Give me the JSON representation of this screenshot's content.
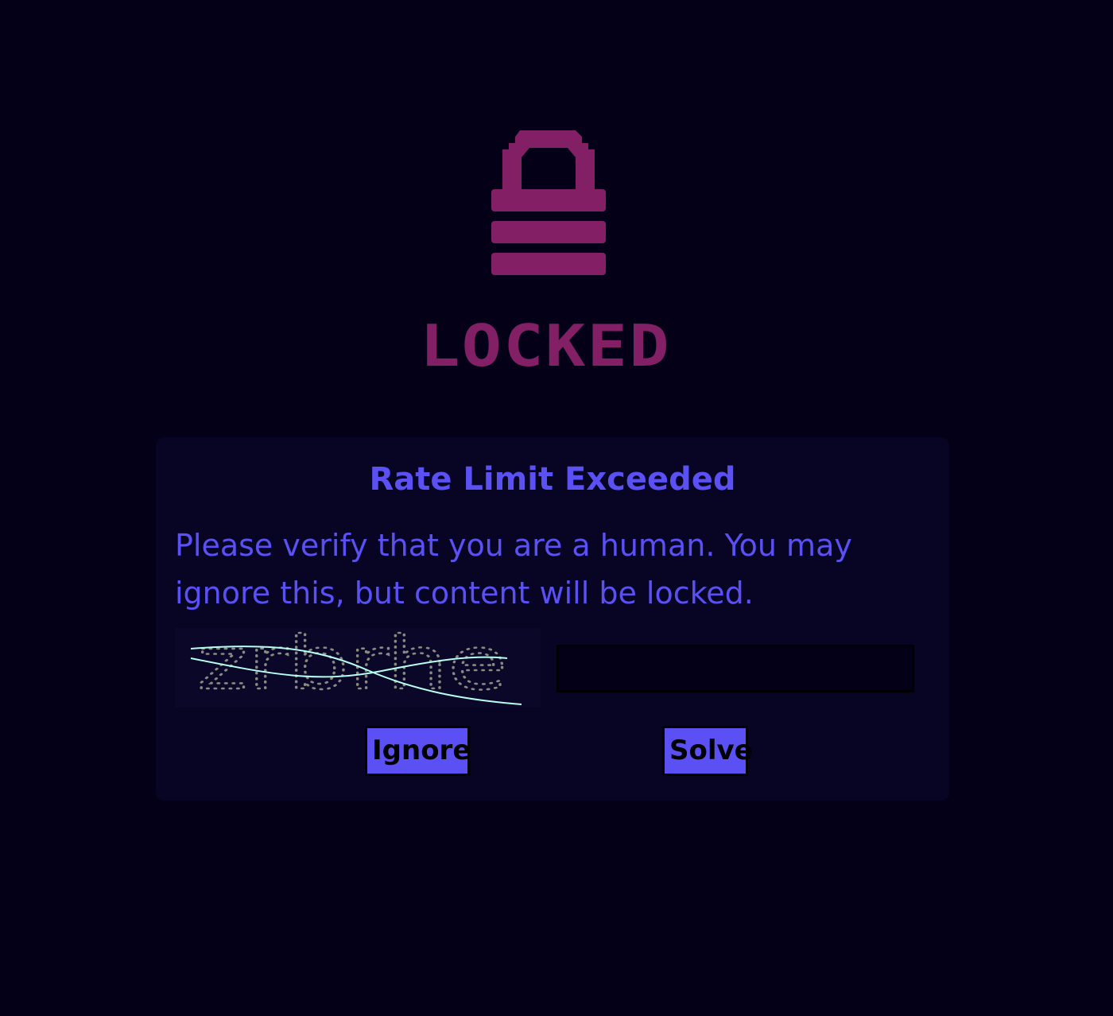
{
  "colors": {
    "background": "#040018",
    "accent": "#5b50f4",
    "lock": "#821f65",
    "dialog": "#070424",
    "captcha_noise": "#b6fff0"
  },
  "lock": {
    "icon": "padlock-icon",
    "title": "LOCKED"
  },
  "dialog": {
    "title": "Rate Limit Exceeded",
    "message": "Please verify that you are a human. You may ignore this, but content will be locked."
  },
  "captcha": {
    "text": "zrbrhe",
    "answer_value": ""
  },
  "buttons": {
    "ignore_label": "Ignore",
    "solve_label": "Solve"
  }
}
